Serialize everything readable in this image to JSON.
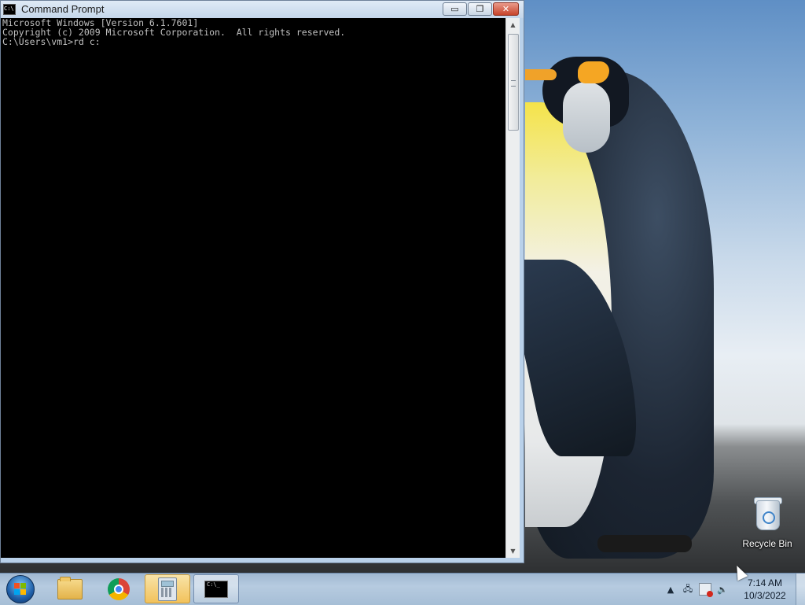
{
  "window": {
    "title": "Command Prompt",
    "buttons": {
      "minimize": "▭",
      "restore": "❐",
      "close": "✕"
    }
  },
  "console": {
    "lines": [
      "Microsoft Windows [Version 6.1.7601]",
      "Copyright (c) 2009 Microsoft Corporation.  All rights reserved.",
      "",
      "C:\\Users\\vm1>rd c:"
    ]
  },
  "desktop": {
    "icons": [
      {
        "label": "Recycle Bin",
        "icon": "recycle-bin-icon"
      }
    ]
  },
  "taskbar": {
    "items": [
      {
        "name": "windows-explorer",
        "icon": "folder-icon"
      },
      {
        "name": "google-chrome",
        "icon": "chrome-icon"
      },
      {
        "name": "calculator",
        "icon": "calculator-icon"
      },
      {
        "name": "command-prompt",
        "icon": "cmd-icon",
        "active": true
      }
    ],
    "tray": {
      "show_hidden": "▲",
      "volume": "🔈"
    },
    "clock": {
      "time": "7:14 AM",
      "date": "10/3/2022"
    }
  }
}
